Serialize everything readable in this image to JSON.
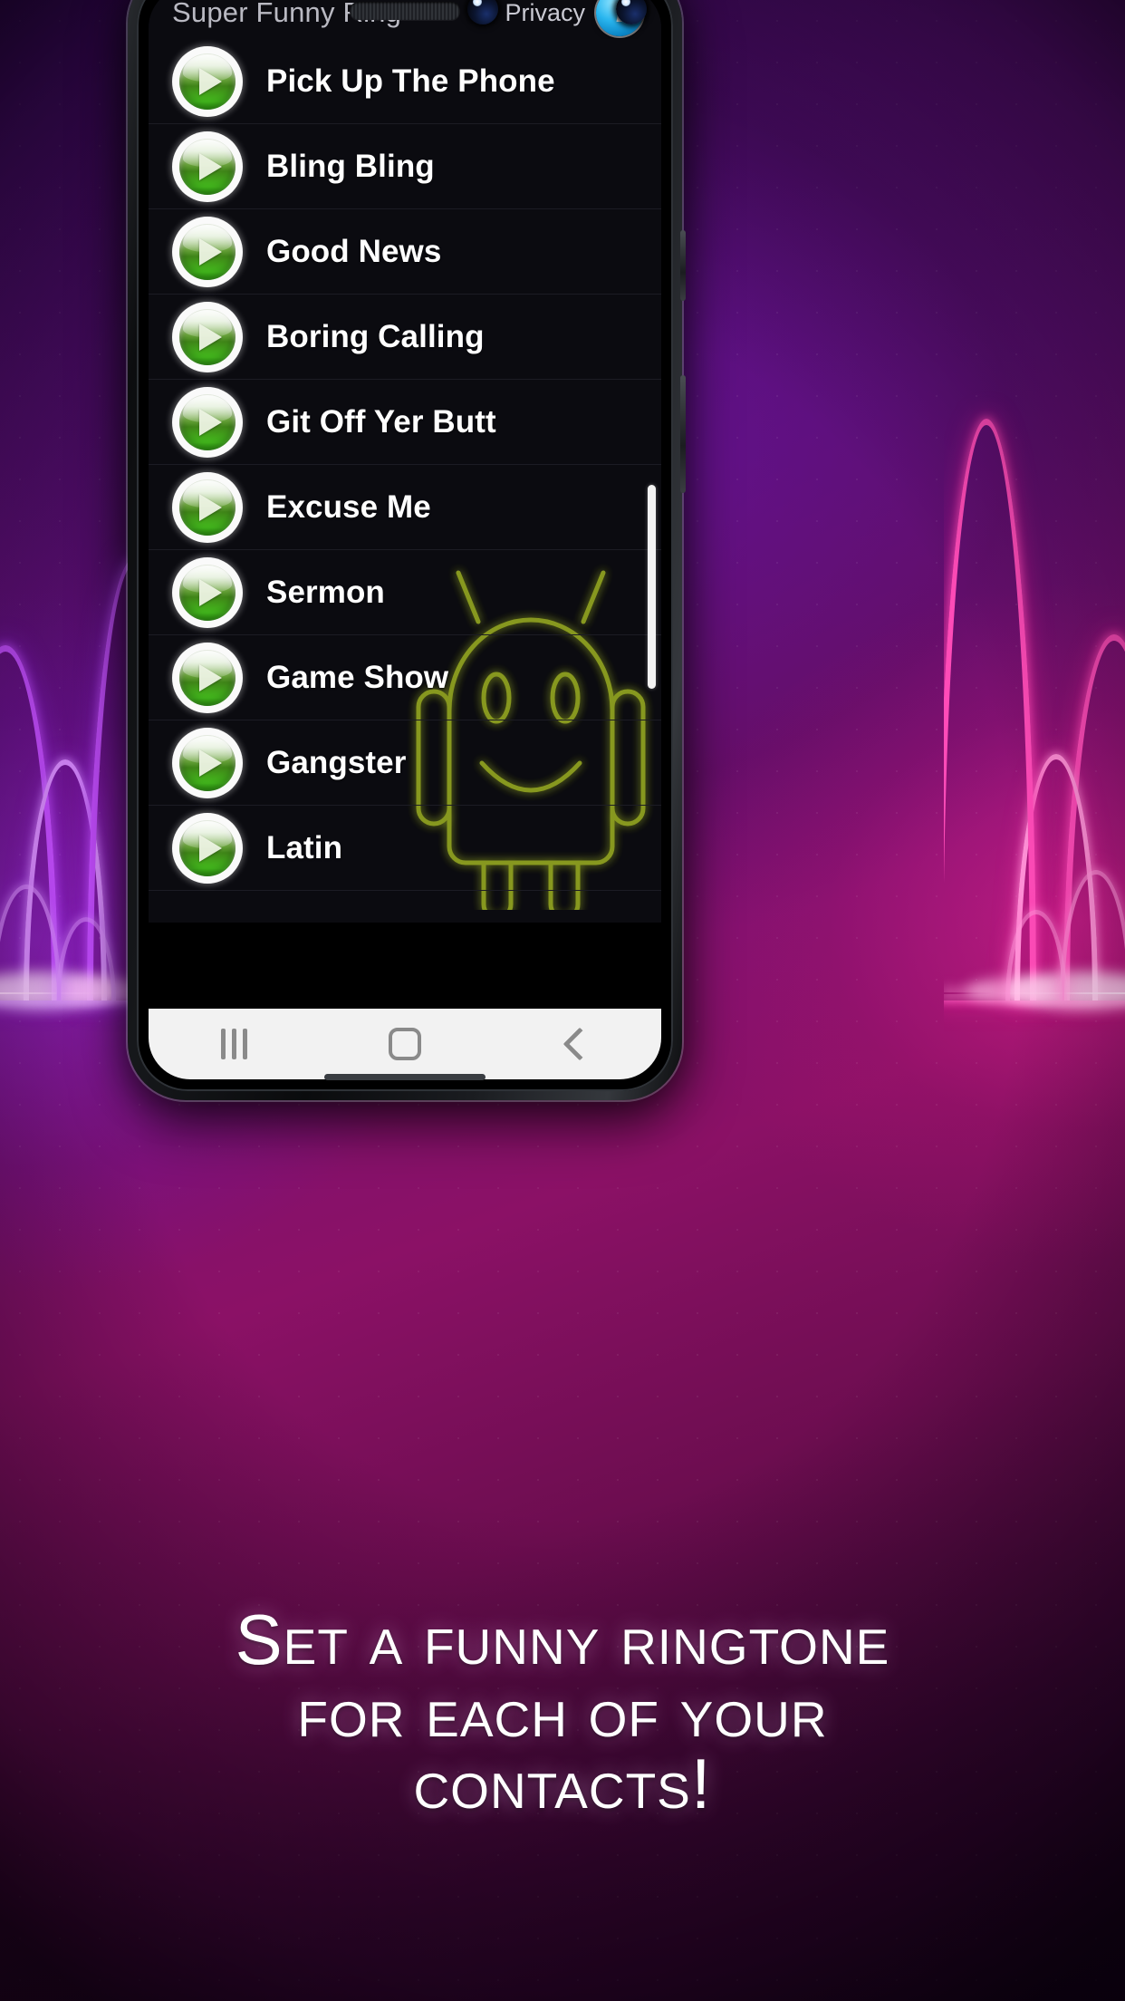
{
  "background": {
    "style": "neon-waveform-gradient",
    "colors": {
      "purple": "#8a2be2",
      "magenta": "#ff2ea0",
      "left_wave": "#c44dff",
      "right_wave": "#ff4bb8",
      "deep_bg": "#3d0a63"
    }
  },
  "phone": {
    "nav_bar": {
      "recents_label": "recents",
      "home_label": "home",
      "back_label": "back"
    },
    "home_indicator": "home-indicator"
  },
  "app": {
    "title": "Super Funny Ring",
    "privacy_label": "Privacy",
    "info_button_glyph": "i",
    "ringtones": [
      {
        "name": "Pick Up The Phone",
        "action": "play"
      },
      {
        "name": "Bling Bling",
        "action": "play"
      },
      {
        "name": "Good News",
        "action": "play"
      },
      {
        "name": "Boring Calling",
        "action": "play"
      },
      {
        "name": "Git Off Yer Butt",
        "action": "play"
      },
      {
        "name": "Excuse Me",
        "action": "play"
      },
      {
        "name": "Sermon",
        "action": "play"
      },
      {
        "name": "Game Show",
        "action": "play"
      },
      {
        "name": "Gangster",
        "action": "play"
      },
      {
        "name": "Latin",
        "action": "play"
      }
    ],
    "scrollbar": {
      "visible": true
    },
    "mascot": "android-robot-neon-outline",
    "accent_green": "#3fbb14",
    "accent_blue": "#2ab6ef"
  },
  "promo": {
    "line1": "Set a funny ringtone",
    "line2": "for each of your",
    "line3": "contacts!"
  }
}
